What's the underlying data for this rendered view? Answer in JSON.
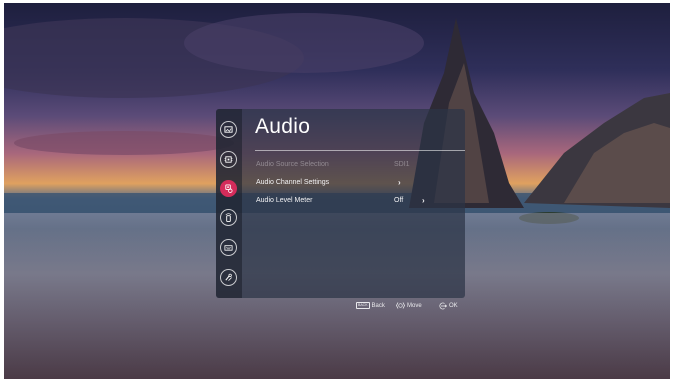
{
  "menu": {
    "title": "Audio",
    "categories": [
      {
        "icon": "picture-icon",
        "active": false
      },
      {
        "icon": "processor-icon",
        "active": false
      },
      {
        "icon": "audio-settings-icon",
        "active": true
      },
      {
        "icon": "remote-icon",
        "active": false
      },
      {
        "icon": "keyboard-icon",
        "active": false
      },
      {
        "icon": "tools-icon",
        "active": false
      }
    ],
    "items": [
      {
        "label": "Audio Source Selection",
        "value": "SDI1",
        "enabled": false
      },
      {
        "label": "Audio Channel Settings",
        "value": "",
        "chevron": "›",
        "enabled": true
      },
      {
        "label": "Audio Level Meter",
        "value": "Off",
        "chevron": "›",
        "enabled": true
      }
    ]
  },
  "footer": {
    "back_key": "BACK",
    "back_label": "Back",
    "move_label": "Move",
    "ok_label": "OK"
  },
  "colors": {
    "accent": "#d42c5b",
    "panel": "#2d3446"
  }
}
